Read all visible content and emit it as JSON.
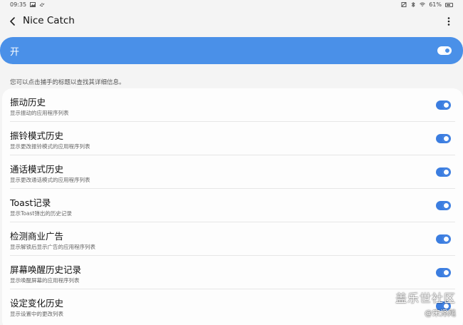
{
  "status_bar": {
    "time": "09:35",
    "battery": "61%"
  },
  "app_bar": {
    "title": "Nice Catch"
  },
  "master": {
    "label": "开",
    "enabled": true
  },
  "info_text": "您可以点击捕手的标题以查找其详细信息。",
  "settings": [
    {
      "title": "振动历史",
      "subtitle": "显示振动的应用程序列表",
      "enabled": true
    },
    {
      "title": "振铃模式历史",
      "subtitle": "显示更改振铃模式的应用程序列表",
      "enabled": true
    },
    {
      "title": "通话模式历史",
      "subtitle": "显示更改通话模式的应用程序列表",
      "enabled": true
    },
    {
      "title": "Toast记录",
      "subtitle": "显示Toast弹出的历史记录",
      "enabled": true
    },
    {
      "title": "检测商业广告",
      "subtitle": "显示解锁后显示广告的应用程序列表",
      "enabled": true
    },
    {
      "title": "屏幕唤醒历史记录",
      "subtitle": "显示唤醒屏幕的应用程序列表",
      "enabled": true
    },
    {
      "title": "设定变化历史",
      "subtitle": "显示设置中的更改列表",
      "enabled": true
    }
  ],
  "watermark": {
    "main": "盖乐世社区",
    "sub": "@宋泽飚"
  },
  "colors": {
    "accent": "#4a90e8",
    "toggle_on": "#3b7de0",
    "background": "#f4f4f4"
  }
}
